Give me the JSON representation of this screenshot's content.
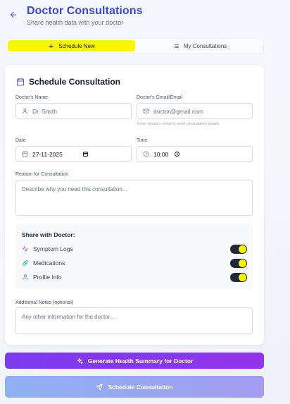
{
  "header": {
    "title": "Doctor Consultations",
    "subtitle": "Share health data with your doctor"
  },
  "tabs": [
    {
      "label": "Schedule New",
      "icon": "plus-icon",
      "active": true
    },
    {
      "label": "My Consultations",
      "icon": "list-icon",
      "active": false
    }
  ],
  "form": {
    "title": "Schedule Consultation",
    "doctor_name": {
      "label": "Doctor's Name",
      "placeholder": "Dr. Smith"
    },
    "doctor_email": {
      "label": "Doctor's Gmail/Email",
      "placeholder": "doctor@gmail.com",
      "hint": "Enter doctor's email to send consultation details"
    },
    "date": {
      "label": "Date",
      "value": "27-11-2025"
    },
    "time": {
      "label": "Time",
      "value": "10:00"
    },
    "reason": {
      "label": "Reason for Consultation",
      "placeholder": "Describe why you need this consultation..."
    },
    "share": {
      "title": "Share with Doctor:",
      "items": [
        {
          "label": "Symptom Logs",
          "icon": "activity-icon",
          "enabled": true
        },
        {
          "label": "Medications",
          "icon": "pill-icon",
          "enabled": true
        },
        {
          "label": "Profile Info",
          "icon": "user-icon",
          "enabled": true
        }
      ]
    },
    "notes": {
      "label": "Additional Notes (optional)",
      "placeholder": "Any other information for the doctor..."
    }
  },
  "actions": {
    "generate_label": "Generate Health Summary for Doctor",
    "schedule_label": "Schedule Consultation"
  },
  "colors": {
    "accent": "#3b48c9",
    "highlight": "#fbf502",
    "generate_button": "#8b35ec",
    "schedule_button": "#9aa8f2"
  }
}
